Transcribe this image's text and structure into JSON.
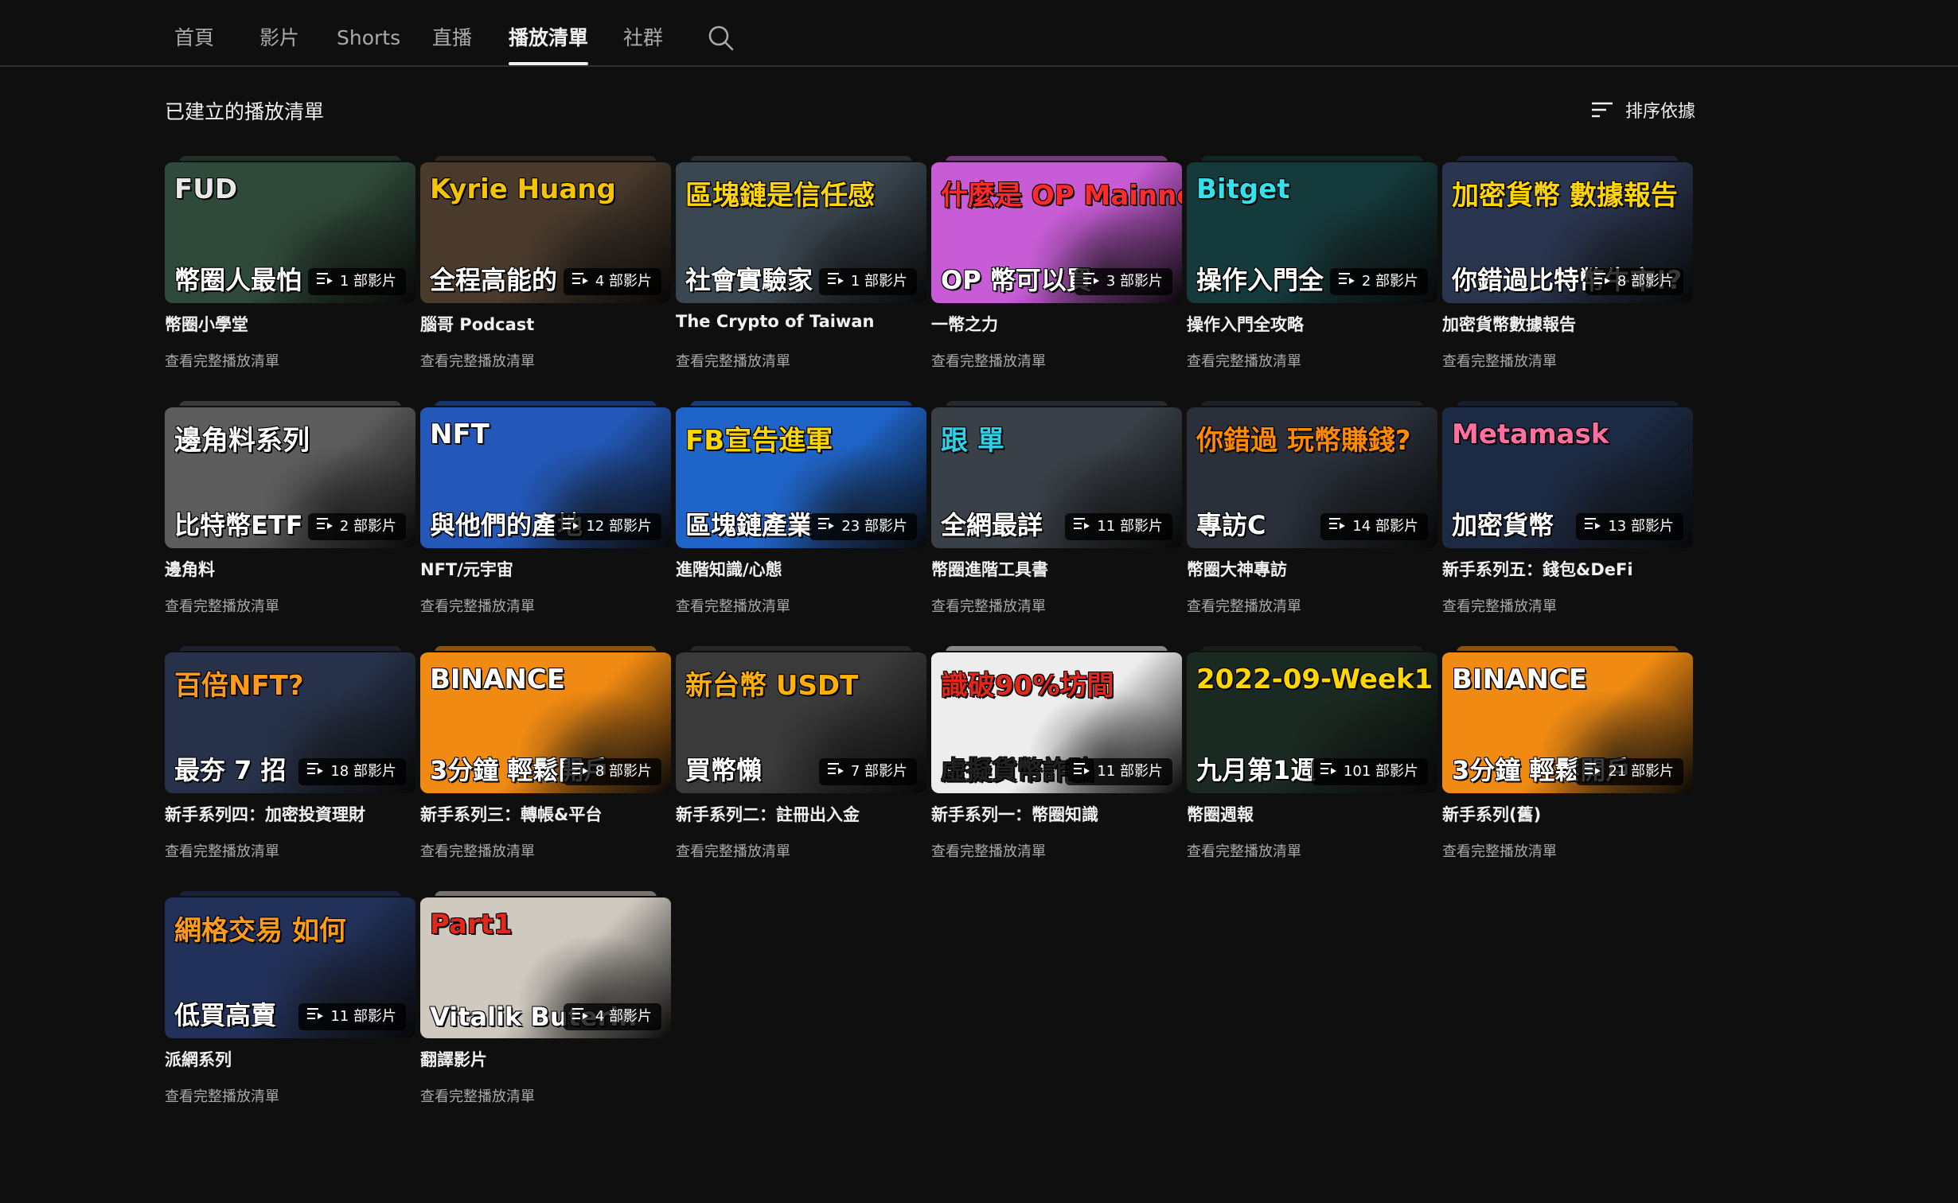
{
  "tabs": [
    {
      "label": "首頁",
      "active": false
    },
    {
      "label": "影片",
      "active": false
    },
    {
      "label": "Shorts",
      "active": false
    },
    {
      "label": "直播",
      "active": false
    },
    {
      "label": "播放清單",
      "active": true
    },
    {
      "label": "社群",
      "active": false
    }
  ],
  "search_icon": "search-icon",
  "section_title": "已建立的播放清單",
  "sort": {
    "label": "排序依據",
    "icon": "sort-icon"
  },
  "view_full_label": "查看完整播放清單",
  "playlists": [
    {
      "title": "幣圈小學堂",
      "count": "1 部影片",
      "thumb": {
        "bg": "#2f4a3a",
        "accent": "#e8e8e8",
        "line1": "FUD",
        "line2": "幣圈人最怕"
      }
    },
    {
      "title": "腦哥 Podcast",
      "count": "4 部影片",
      "thumb": {
        "bg": "#4a3a2c",
        "accent": "#f5c400",
        "line1": "Kyrie Huang",
        "line2": "全程高能的"
      }
    },
    {
      "title": "The Crypto of Taiwan",
      "count": "1 部影片",
      "thumb": {
        "bg": "#3a4650",
        "accent": "#ffd600",
        "line1": "區塊鏈是信任感",
        "line2": "社會實驗家"
      }
    },
    {
      "title": "一幣之力",
      "count": "3 部影片",
      "thumb": {
        "bg": "#c75cd6",
        "accent": "#ff2a2a",
        "line1": "什麼是 OP Mainnet？",
        "line2": "OP 幣可以買"
      }
    },
    {
      "title": "操作入門全攻略",
      "count": "2 部影片",
      "thumb": {
        "bg": "#153a3c",
        "accent": "#35e0e8",
        "line1": "Bitget",
        "line2": "操作入門全"
      }
    },
    {
      "title": "加密貨幣數據報告",
      "count": "8 部影片",
      "thumb": {
        "bg": "#2a3550",
        "accent": "#ffd600",
        "line1": "加密貨幣 數據報告",
        "line2": "你錯過比特幣牛市!?"
      }
    },
    {
      "title": "邊角料",
      "count": "2 部影片",
      "thumb": {
        "bg": "#5d5d5d",
        "accent": "#ffffff",
        "line1": "邊角料系列",
        "line2": "比特幣ETF"
      }
    },
    {
      "title": "NFT/元宇宙",
      "count": "12 部影片",
      "thumb": {
        "bg": "#2358b8",
        "accent": "#ffffff",
        "line1": "NFT",
        "line2": "與他們的產地"
      }
    },
    {
      "title": "進階知識/心態",
      "count": "23 部影片",
      "thumb": {
        "bg": "#1f64c8",
        "accent": "#ffd600",
        "line1": "FB宣告進軍",
        "line2": "區塊鏈產業"
      }
    },
    {
      "title": "幣圈進階工具書",
      "count": "11 部影片",
      "thumb": {
        "bg": "#3a4048",
        "accent": "#2fd0e8",
        "line1": "跟  單",
        "line2": "全網最詳"
      }
    },
    {
      "title": "幣圈大神專訪",
      "count": "14 部影片",
      "thumb": {
        "bg": "#2a2f3a",
        "accent": "#ff8a00",
        "line1": "你錯過 玩幣賺錢?",
        "line2": "專訪C"
      }
    },
    {
      "title": "新手系列五：錢包&DeFi",
      "count": "13 部影片",
      "thumb": {
        "bg": "#1d2a44",
        "accent": "#ff6fa0",
        "line1": "Metamask",
        "line2": "加密貨幣"
      }
    },
    {
      "title": "新手系列四：加密投資理財",
      "count": "18 部影片",
      "thumb": {
        "bg": "#27324a",
        "accent": "#ff9b1a",
        "line1": "百倍NFT?",
        "line2": "最夯 7 招"
      }
    },
    {
      "title": "新手系列三：轉帳&平台",
      "count": "8 部影片",
      "thumb": {
        "bg": "#f08a12",
        "accent": "#ffffff",
        "line1": "BINANCE",
        "line2": "3分鐘 輕鬆開戶"
      }
    },
    {
      "title": "新手系列二：註冊出入金",
      "count": "7 部影片",
      "thumb": {
        "bg": "#3a3a3a",
        "accent": "#ffb000",
        "line1": "新台幣  USDT",
        "line2": "買幣懶"
      }
    },
    {
      "title": "新手系列一：幣圈知識",
      "count": "11 部影片",
      "thumb": {
        "bg": "#ededed",
        "accent": "#e0281c",
        "line1": "識破90%坊間",
        "line2": "虛擬貨幣詐騙"
      }
    },
    {
      "title": "幣圈週報",
      "count": "101 部影片",
      "thumb": {
        "bg": "#1a2a22",
        "accent": "#ffd600",
        "line1": "2022-09-Week1",
        "line2": "九月第1週"
      }
    },
    {
      "title": "新手系列(舊)",
      "count": "21 部影片",
      "thumb": {
        "bg": "#f08a12",
        "accent": "#ffffff",
        "line1": "BINANCE",
        "line2": "3分鐘 輕鬆開戶"
      }
    },
    {
      "title": "派網系列",
      "count": "11 部影片",
      "thumb": {
        "bg": "#22315a",
        "accent": "#ff9b1a",
        "line1": "網格交易 如何",
        "line2": "低買高賣"
      }
    },
    {
      "title": "翻譯影片",
      "count": "4 部影片",
      "thumb": {
        "bg": "#cfc9c0",
        "accent": "#e0281c",
        "line1": "Part1",
        "line2": "Vitalik Buterin"
      }
    }
  ]
}
